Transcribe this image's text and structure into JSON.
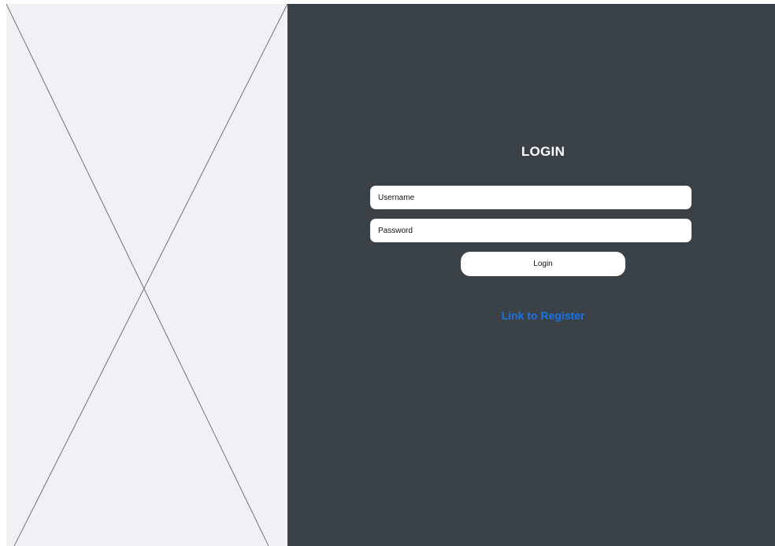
{
  "login": {
    "title": "LOGIN",
    "username_placeholder": "Username",
    "password_placeholder": "Password",
    "button_label": "Login",
    "register_link": "Link to Register"
  },
  "colors": {
    "placeholder_bg": "#f0f0f5",
    "panel_bg": "#3b4247",
    "link": "#1a73e8"
  }
}
